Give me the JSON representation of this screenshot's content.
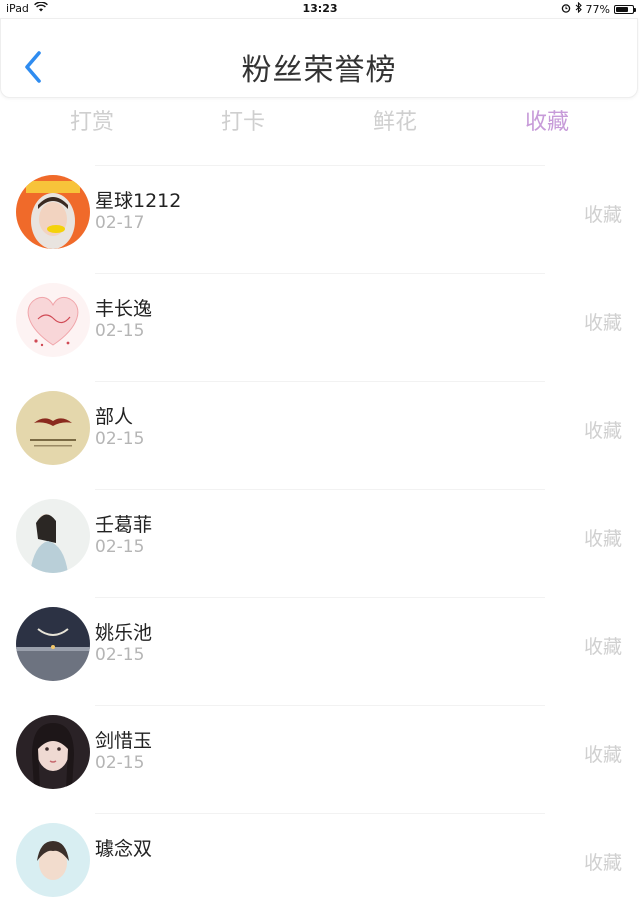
{
  "status_bar": {
    "device": "iPad",
    "time": "13:23",
    "battery": "77%",
    "battery_level": 0.77,
    "icons": [
      "wifi-icon",
      "alarm-icon",
      "bluetooth-icon",
      "battery-icon"
    ]
  },
  "header": {
    "title": "粉丝荣誉榜",
    "back_icon": "chevron-left-icon",
    "accent_color": "#2f8cf0"
  },
  "tabs": [
    {
      "label": "打赏",
      "active": false
    },
    {
      "label": "打卡",
      "active": false
    },
    {
      "label": "鲜花",
      "active": false
    },
    {
      "label": "收藏",
      "active": true
    }
  ],
  "active_tab_color": "#c79bd9",
  "fans": [
    {
      "name": "星球1212",
      "date": "02-17",
      "action": "收藏"
    },
    {
      "name": "丰长逸",
      "date": "02-15",
      "action": "收藏"
    },
    {
      "name": "部人",
      "date": "02-15",
      "action": "收藏"
    },
    {
      "name": "壬葛菲",
      "date": "02-15",
      "action": "收藏"
    },
    {
      "name": "姚乐池",
      "date": "02-15",
      "action": "收藏"
    },
    {
      "name": "剑惜玉",
      "date": "02-15",
      "action": "收藏"
    },
    {
      "name": "璩念双",
      "date": "",
      "action": "收藏"
    }
  ]
}
